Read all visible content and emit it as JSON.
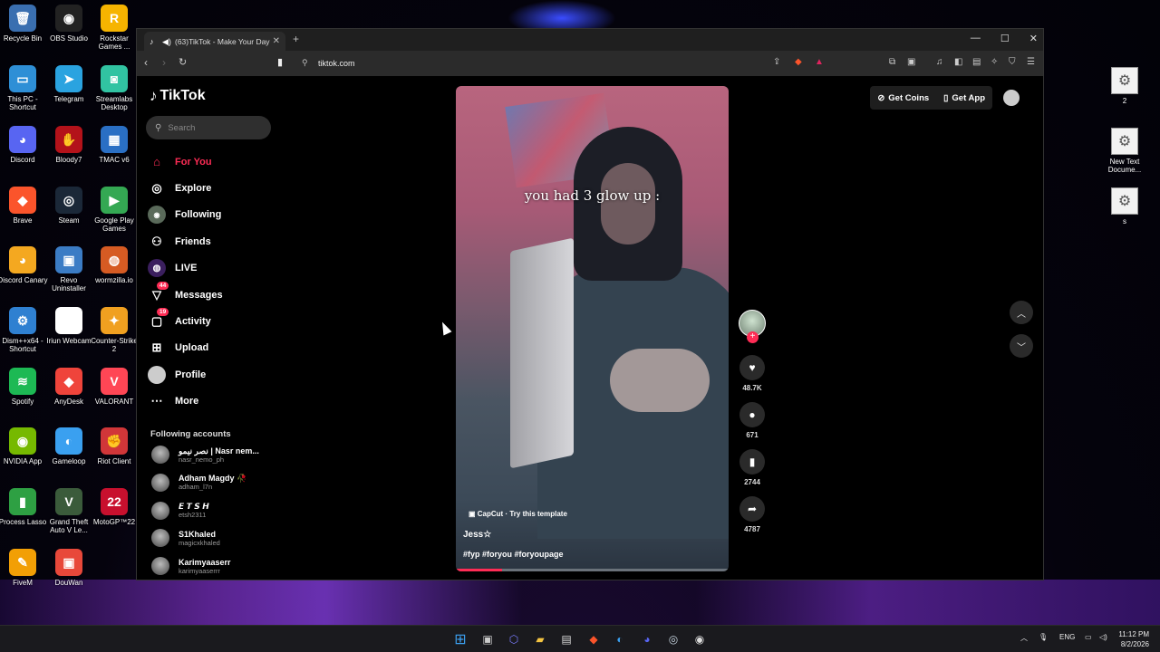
{
  "desktop": {
    "icons": [
      {
        "label": "Recycle Bin",
        "glyph": "🗑",
        "color": "#3a6fb0"
      },
      {
        "label": "OBS Studio",
        "glyph": "◉",
        "color": "#222"
      },
      {
        "label": "Rockstar Games ...",
        "glyph": "R",
        "color": "#f6b400"
      },
      {
        "label": "This PC - Shortcut",
        "glyph": "▭",
        "color": "#2e8fd6"
      },
      {
        "label": "Telegram",
        "glyph": "➤",
        "color": "#2aa3e0"
      },
      {
        "label": "Streamlabs Desktop",
        "glyph": "◙",
        "color": "#31c3a2"
      },
      {
        "label": "Discord",
        "glyph": "◕",
        "color": "#5865f2"
      },
      {
        "label": "Bloody7",
        "glyph": "✋",
        "color": "#b3121a"
      },
      {
        "label": "TMAC v6",
        "glyph": "▦",
        "color": "#2a6fc4"
      },
      {
        "label": "Brave",
        "glyph": "◆",
        "color": "#fb542b"
      },
      {
        "label": "Steam",
        "glyph": "◎",
        "color": "#1b2838"
      },
      {
        "label": "Google Play Games",
        "glyph": "▶",
        "color": "#34a853"
      },
      {
        "label": "Discord Canary",
        "glyph": "◕",
        "color": "#f4a820"
      },
      {
        "label": "Revo Uninstaller",
        "glyph": "▣",
        "color": "#3b7cc5"
      },
      {
        "label": "wormzilla.io",
        "glyph": "◍",
        "color": "#d65b23"
      },
      {
        "label": "Dism++x64 - Shortcut",
        "glyph": "⚙",
        "color": "#2f80d1"
      },
      {
        "label": "Iriun Webcam",
        "glyph": "◯",
        "color": "#ffffff"
      },
      {
        "label": "Counter-Strike 2",
        "glyph": "✦",
        "color": "#f0a020"
      },
      {
        "label": "Spotify",
        "glyph": "≋",
        "color": "#1db954"
      },
      {
        "label": "AnyDesk",
        "glyph": "◆",
        "color": "#ef443b"
      },
      {
        "label": "VALORANT",
        "glyph": "V",
        "color": "#ff4655"
      },
      {
        "label": "NVIDIA App",
        "glyph": "◉",
        "color": "#76b900"
      },
      {
        "label": "Gameloop",
        "glyph": "◐",
        "color": "#3aa0f0"
      },
      {
        "label": "Riot Client",
        "glyph": "✊",
        "color": "#d13639"
      },
      {
        "label": "Process Lasso",
        "glyph": "▮",
        "color": "#2ea043"
      },
      {
        "label": "Grand Theft Auto V Le...",
        "glyph": "V",
        "color": "#3b5b3b"
      },
      {
        "label": "MotoGP™22",
        "glyph": "22",
        "color": "#c8102e"
      },
      {
        "label": "FiveM",
        "glyph": "✎",
        "color": "#f29f05"
      },
      {
        "label": "DouWan",
        "glyph": "▣",
        "color": "#e8483a"
      }
    ],
    "right_icons": [
      {
        "label": "2"
      },
      {
        "label": "New Text Docume..."
      },
      {
        "label": "s"
      }
    ]
  },
  "browser": {
    "tab_title": "(63)TikTok - Make Your Day",
    "url": "tiktok.com"
  },
  "tiktok": {
    "logo": "TikTok",
    "search_placeholder": "Search",
    "nav": [
      {
        "label": "For You",
        "icon": "home-icon",
        "glyph": "⌂",
        "active": true
      },
      {
        "label": "Explore",
        "icon": "compass-icon",
        "glyph": "◎",
        "active": false
      },
      {
        "label": "Following",
        "icon": "following-avatar-icon",
        "glyph": "◉",
        "active": false
      },
      {
        "label": "Friends",
        "icon": "friends-icon",
        "glyph": "⚇",
        "active": false
      },
      {
        "label": "LIVE",
        "icon": "live-icon",
        "glyph": "◍",
        "active": false
      },
      {
        "label": "Messages",
        "icon": "messages-icon",
        "glyph": "▽",
        "badge": "44",
        "active": false
      },
      {
        "label": "Activity",
        "icon": "activity-icon",
        "glyph": "▢",
        "badge": "19",
        "active": false
      },
      {
        "label": "Upload",
        "icon": "upload-icon",
        "glyph": "⊞",
        "active": false
      },
      {
        "label": "Profile",
        "icon": "profile-avatar-icon",
        "glyph": "●",
        "active": false
      },
      {
        "label": "More",
        "icon": "more-icon",
        "glyph": "⋯",
        "active": false
      }
    ],
    "following_title": "Following accounts",
    "accounts": [
      {
        "name": "نصر نيمو | Nasr nem...",
        "username": "nasr_nemo_ph"
      },
      {
        "name": "Adham Magdy 🥀",
        "username": "adham_l7n"
      },
      {
        "name": "𝙀 𝙏 𝙎 𝙃",
        "username": "etsh2311"
      },
      {
        "name": "S1Khaled",
        "username": "magicxkhaled"
      },
      {
        "name": "Karimyaaserr",
        "username": "karimyaaserrr"
      }
    ],
    "top_right": {
      "get_coins": "Get Coins",
      "get_app": "Get App"
    },
    "video": {
      "caption": "you had 3 glow up :",
      "template": "CapCut · Try this template",
      "author": "Jess☆",
      "hashtags": "#fyp #foryou #foryoupage",
      "progress": 0.17
    },
    "actions": {
      "likes": "48.7K",
      "comments": "671",
      "saves": "2744",
      "shares": "4787"
    }
  },
  "taskbar": {
    "language": "ENG",
    "time": "11:12 PM",
    "date": "8/2/2026"
  }
}
